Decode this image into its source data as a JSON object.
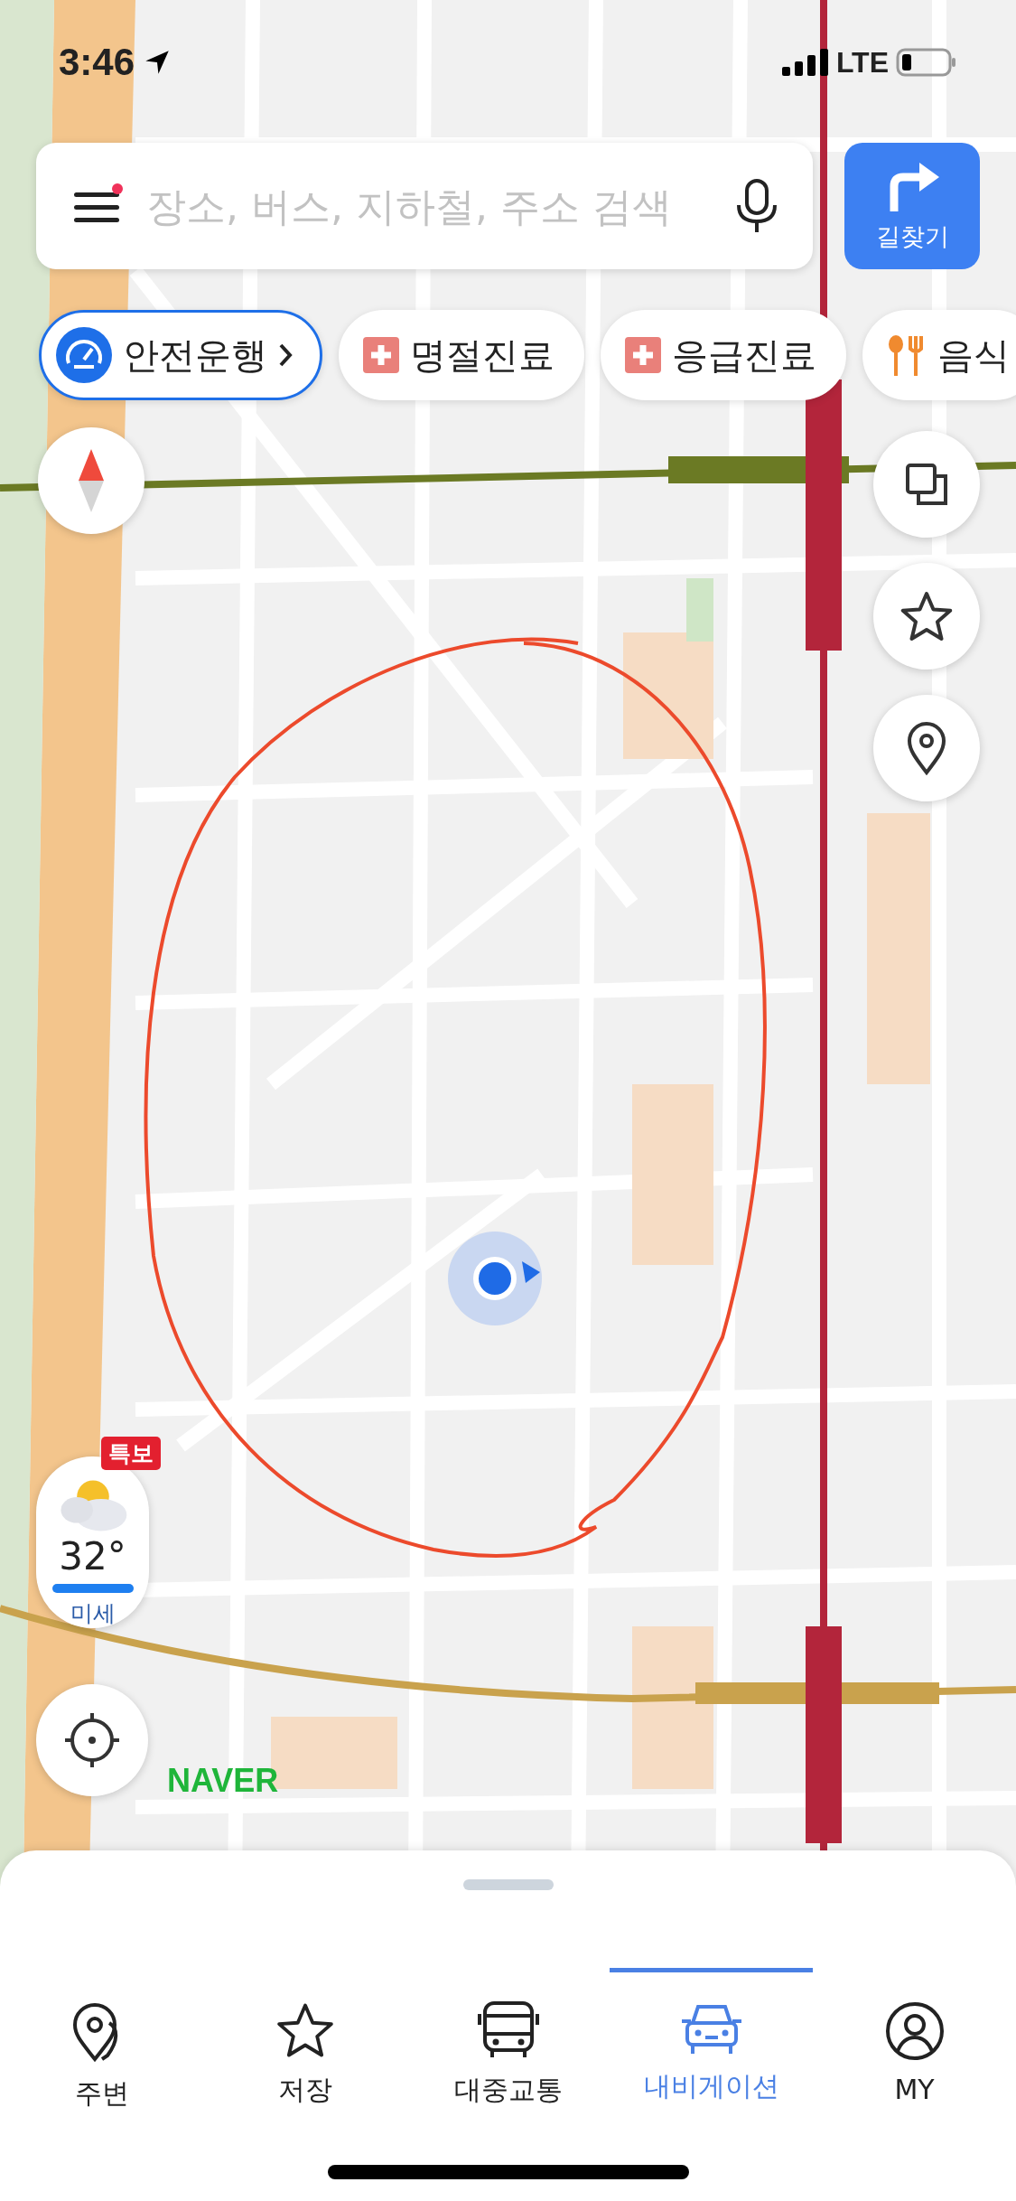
{
  "status_bar": {
    "time": "3:46",
    "network": "LTE"
  },
  "search": {
    "placeholder": "장소, 버스, 지하철, 주소 검색",
    "menu_badge": true
  },
  "route_button": {
    "label": "길찾기"
  },
  "chips": [
    {
      "kind": "drive",
      "label": "안전운행"
    },
    {
      "kind": "medical",
      "label": "명절진료"
    },
    {
      "kind": "medical",
      "label": "응급진료"
    },
    {
      "kind": "food",
      "label": "음식"
    }
  ],
  "weather": {
    "alert": "특보",
    "temperature": "32°",
    "dust_label": "미세"
  },
  "map_logo": "NAVER",
  "tabs": [
    {
      "kind": "nearby",
      "label": "주변",
      "selected": false
    },
    {
      "kind": "saved",
      "label": "저장",
      "selected": false
    },
    {
      "kind": "transit",
      "label": "대중교통",
      "selected": false
    },
    {
      "kind": "navigation",
      "label": "내비게이션",
      "selected": true
    },
    {
      "kind": "my",
      "label": "MY",
      "selected": false
    }
  ]
}
